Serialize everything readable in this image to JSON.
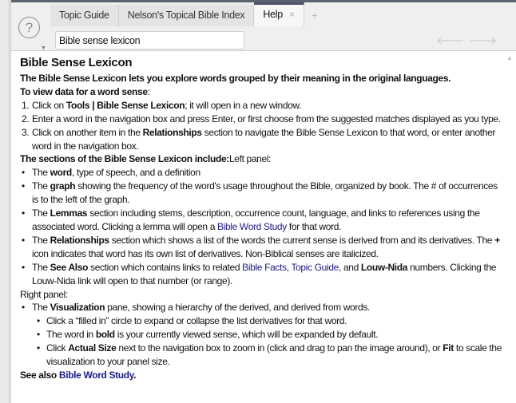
{
  "tabs": [
    {
      "label": "Topic Guide"
    },
    {
      "label": "Nelson's Topical Bible Index"
    },
    {
      "label": "Help",
      "close": "×"
    }
  ],
  "new_tab": "+",
  "help_icon": "?",
  "nav_input": "Bible sense lexicon",
  "arrows": {
    "back": "🡐",
    "forward": "🡒"
  },
  "title": "Bible Sense Lexicon",
  "lines": [
    {
      "kind": "p",
      "segs": [
        {
          "t": "The Bible Sense Lexicon lets you explore words grouped by their meaning in the original languages.",
          "b": true
        }
      ]
    },
    {
      "kind": "p",
      "segs": [
        {
          "t": "To view data for a word sense",
          "b": true
        },
        {
          "t": ":"
        }
      ]
    },
    {
      "kind": "ol",
      "m": "1.",
      "segs": [
        {
          "t": "Click on "
        },
        {
          "t": "Tools | Bible Sense Lexicon",
          "b": true
        },
        {
          "t": "; it will open in a new window."
        }
      ]
    },
    {
      "kind": "ol",
      "m": "2.",
      "segs": [
        {
          "t": "Enter a word in the navigation box and press Enter, or first choose from the suggested matches displayed as you type."
        }
      ]
    },
    {
      "kind": "ol",
      "m": "3.",
      "segs": [
        {
          "t": "Click on another item in the "
        },
        {
          "t": "Relationships",
          "b": true
        },
        {
          "t": " section to navigate the Bible Sense Lexicon to that word, or enter another word in the navigation box."
        }
      ]
    },
    {
      "kind": "p",
      "segs": [
        {
          "t": "The sections of the Bible Sense Lexicon include:",
          "b": true
        },
        {
          "t": "Left panel:"
        }
      ]
    },
    {
      "kind": "ul",
      "m": "•",
      "segs": [
        {
          "t": "The "
        },
        {
          "t": "word",
          "b": true
        },
        {
          "t": ", type of speech, and a definition"
        }
      ]
    },
    {
      "kind": "ul",
      "m": "•",
      "segs": [
        {
          "t": "The "
        },
        {
          "t": "graph",
          "b": true
        },
        {
          "t": " showing the frequency of the word's usage throughout the Bible, organized by book. The # of occurrences is to the left of the graph."
        }
      ]
    },
    {
      "kind": "ul",
      "m": "•",
      "segs": [
        {
          "t": "The "
        },
        {
          "t": "Lemmas",
          "b": true
        },
        {
          "t": " section including stems, description, occurrence count, language, and links to references using the associated word. Clicking a lemma will open a "
        },
        {
          "t": "Bible Word Study",
          "link": true
        },
        {
          "t": " for that word."
        }
      ]
    },
    {
      "kind": "ul",
      "m": "•",
      "segs": [
        {
          "t": "The "
        },
        {
          "t": "Relationships",
          "b": true
        },
        {
          "t": " section which shows a list of the words the current sense is derived from and its derivatives. The "
        },
        {
          "t": "+",
          "b": true
        },
        {
          "t": " icon indicates that word has its own list of derivatives. Non-Biblical senses are italicized."
        }
      ]
    },
    {
      "kind": "ul",
      "m": "•",
      "segs": [
        {
          "t": "The "
        },
        {
          "t": "See Also",
          "b": true
        },
        {
          "t": " section which contains links to related "
        },
        {
          "t": "Bible Facts",
          "link": true
        },
        {
          "t": ", "
        },
        {
          "t": "Topic Guide",
          "link": true
        },
        {
          "t": ", and "
        },
        {
          "t": "Louw-Nida",
          "b": true
        },
        {
          "t": " numbers. Clicking the Louw-Nida link will open to that number (or range)."
        }
      ]
    },
    {
      "kind": "p",
      "segs": [
        {
          "t": "Right panel:"
        }
      ]
    },
    {
      "kind": "ul",
      "m": "•",
      "segs": [
        {
          "t": "The "
        },
        {
          "t": "Visualization",
          "b": true
        },
        {
          "t": " pane, showing a hierarchy of the derived, and derived from words."
        }
      ]
    },
    {
      "kind": "ul2",
      "m": "•",
      "segs": [
        {
          "t": "Click a “filled in” circle to expand or collapse the list derivatives for that word."
        }
      ]
    },
    {
      "kind": "ul2",
      "m": "•",
      "segs": [
        {
          "t": "The word in "
        },
        {
          "t": "bold",
          "b": true
        },
        {
          "t": " is your currently viewed sense, which will be expanded by default."
        }
      ]
    },
    {
      "kind": "ul2",
      "m": "•",
      "segs": [
        {
          "t": "Click "
        },
        {
          "t": "Actual Size",
          "b": true
        },
        {
          "t": " next to the navigation box to zoom in (click and drag to pan the image around), or "
        },
        {
          "t": "Fit",
          "b": true
        },
        {
          "t": " to scale the visualization to your panel size."
        }
      ]
    },
    {
      "kind": "p",
      "segs": [
        {
          "t": "See also ",
          "b": true
        },
        {
          "t": "Bible Word Study",
          "link": true,
          "b": true
        },
        {
          "t": ".",
          "b": true
        }
      ]
    }
  ]
}
